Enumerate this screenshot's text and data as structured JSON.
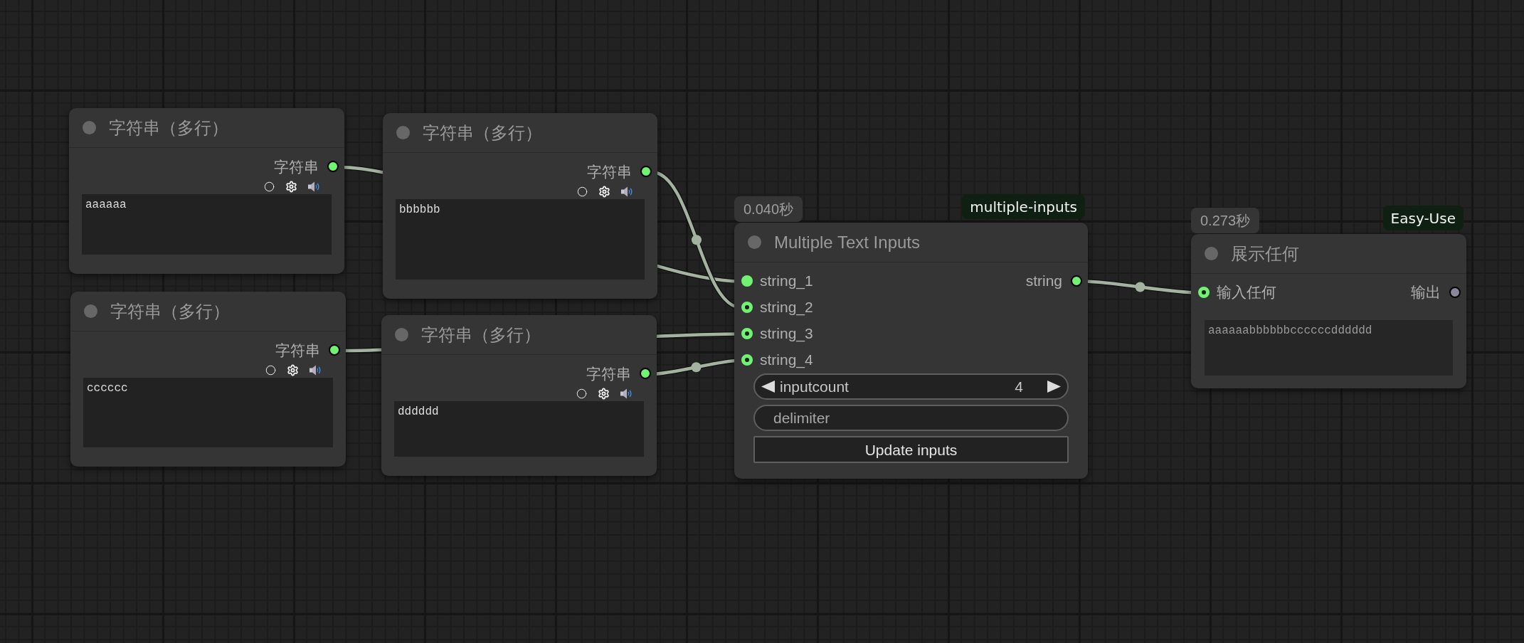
{
  "nodes": [
    {
      "kind": "text",
      "title": "字符串（多行）",
      "outputs": [
        {
          "label": "字符串",
          "color": "#72f272"
        }
      ],
      "value": "aaaaaa"
    },
    {
      "kind": "text",
      "title": "字符串（多行）",
      "outputs": [
        {
          "label": "字符串",
          "color": "#72f272"
        }
      ],
      "value": "cccccc"
    },
    {
      "kind": "text",
      "title": "字符串（多行）",
      "outputs": [
        {
          "label": "字符串",
          "color": "#72f272"
        }
      ],
      "value": "bbbbbb"
    },
    {
      "kind": "text",
      "title": "字符串（多行）",
      "outputs": [
        {
          "label": "字符串",
          "color": "#72f272"
        }
      ],
      "value": "dddddd"
    },
    {
      "kind": "multi",
      "time": "0.040秒",
      "badge": "multiple-inputs",
      "title": "Multiple Text Inputs",
      "inputs": [
        {
          "label": "string_1",
          "kind": "solid",
          "color": "#72f272"
        },
        {
          "label": "string_2",
          "kind": "ring",
          "color": "#72f272"
        },
        {
          "label": "string_3",
          "kind": "ring",
          "color": "#72f272"
        },
        {
          "label": "string_4",
          "kind": "ring",
          "color": "#72f272"
        }
      ],
      "outputs": [
        {
          "label": "string",
          "color": "#72f272"
        }
      ],
      "widgets": [
        {
          "kind": "number",
          "label": "inputcount",
          "value": "4"
        },
        {
          "kind": "text",
          "label": "delimiter"
        },
        {
          "kind": "button",
          "label": "Update inputs"
        }
      ]
    },
    {
      "kind": "display",
      "time": "0.273秒",
      "badge": "Easy-Use",
      "title": "展示任何",
      "inputs": [
        {
          "label": "输入任何",
          "kind": "ring",
          "color": "#72f272"
        }
      ],
      "outputs": [
        {
          "label": "输出",
          "color": "#8b879a"
        }
      ],
      "value": "aaaaaabbbbbbccccccdddddd"
    }
  ]
}
